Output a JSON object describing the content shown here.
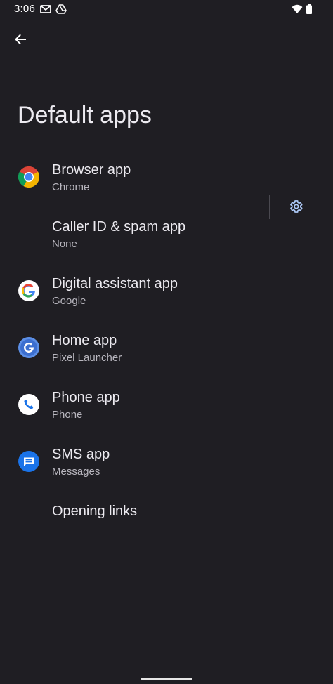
{
  "status_bar": {
    "time": "3:06",
    "icons": [
      "gmail-icon",
      "drive-icon",
      "wifi-icon",
      "battery-icon"
    ]
  },
  "header": {
    "back_icon": "back-arrow-icon",
    "title": "Default apps"
  },
  "items": [
    {
      "title": "Browser app",
      "subtitle": "Chrome",
      "icon": "chrome-icon"
    },
    {
      "title": "Caller ID & spam app",
      "subtitle": "None",
      "icon": ""
    },
    {
      "title": "Digital assistant app",
      "subtitle": "Google",
      "icon": "google-icon"
    },
    {
      "title": "Home app",
      "subtitle": "Pixel Launcher",
      "icon": "pixel-launcher-icon",
      "action_icon": "gear-icon"
    },
    {
      "title": "Phone app",
      "subtitle": "Phone",
      "icon": "phone-icon"
    },
    {
      "title": "SMS app",
      "subtitle": "Messages",
      "icon": "messages-icon"
    },
    {
      "title": "Opening links",
      "subtitle": "",
      "icon": ""
    }
  ],
  "colors": {
    "background": "#1f1e23",
    "text_primary": "#eceaf0",
    "text_secondary": "#b9b7bf"
  }
}
